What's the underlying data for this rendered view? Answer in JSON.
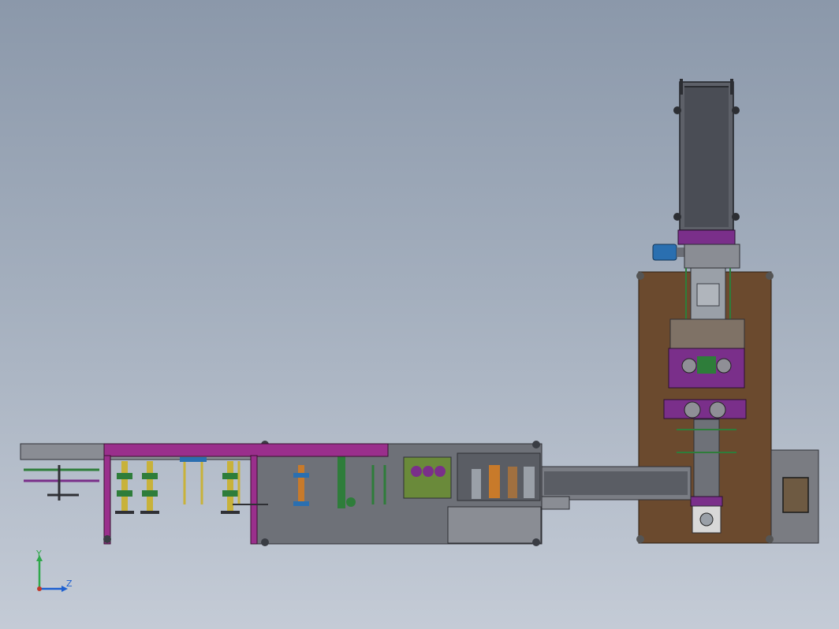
{
  "viewport": {
    "background_top": "#8b98aa",
    "background_bottom": "#c4cbd6"
  },
  "triad": {
    "y_label": "Y",
    "z_label": "Z",
    "y_color": "#2fa84a",
    "z_color": "#1d5fd0"
  },
  "colors": {
    "frame_grey": "#6e7178",
    "frame_dark": "#3a3d44",
    "rail_magenta": "#9a2f8c",
    "base_brown": "#6b4a2e",
    "panel_purple": "#7a2f8a",
    "motor_blue": "#2a6fb0",
    "part_green": "#2e7d3a",
    "part_orange": "#c87a2a",
    "part_yellow": "#c8b23a"
  }
}
